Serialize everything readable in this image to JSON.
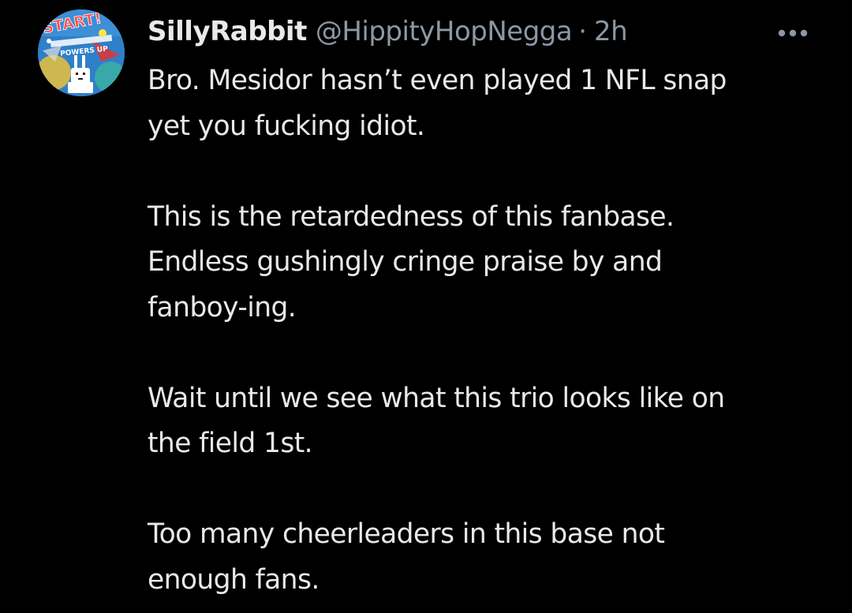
{
  "tweet": {
    "author": {
      "display_name": "SillyRabbit",
      "handle": "@HippityHopNegga",
      "avatar_icon": "rabbit-avatar-icon",
      "avatar_text": "START! POWERS UP"
    },
    "separator": "·",
    "time": "2h",
    "more_icon": "more-options-icon",
    "paragraphs": [
      {
        "lines": [
          "Bro. Mesidor hasn’t even played 1 NFL snap",
          "yet you fucking idiot."
        ]
      },
      {
        "lines": [
          "This is the retardedness of this fanbase.",
          "Endless gushingly cringe praise by and",
          "fanboy-ing."
        ]
      },
      {
        "lines": [
          "Wait until we see what this trio looks like on",
          "the field 1st."
        ]
      },
      {
        "lines": [
          "Too many cheerleaders in this base not",
          "enough fans."
        ]
      }
    ]
  },
  "colors": {
    "background": "#000000",
    "primary_text": "#e7e9ea",
    "secondary_text": "#8b98a5"
  }
}
